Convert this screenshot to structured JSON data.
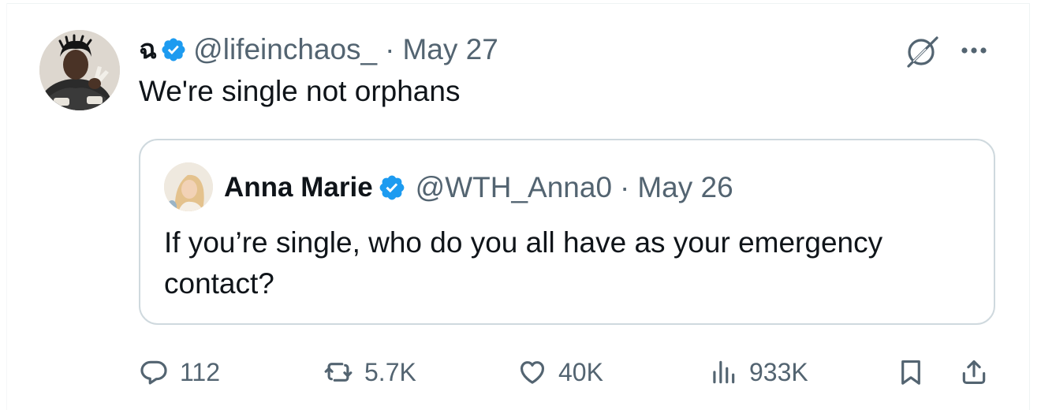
{
  "tweet": {
    "author": {
      "display_name": "ฉ",
      "handle": "@lifeinchaos_",
      "verified": true,
      "avatar_icon": "avatar-photo"
    },
    "separator": "·",
    "date": "May 27",
    "text": "We're single not orphans",
    "quoted": {
      "author": {
        "display_name": "Anna Marie",
        "handle": "@WTH_Anna0",
        "verified": true,
        "avatar_icon": "avatar-photo"
      },
      "separator": "·",
      "date": "May 26",
      "text": "If you’re single, who do you all have as your emergency contact?"
    },
    "actions": {
      "replies": "112",
      "reposts": "5.7K",
      "likes": "40K",
      "views": "933K"
    }
  },
  "colors": {
    "text_primary": "#0f1419",
    "text_secondary": "#536471",
    "verified_blue": "#1d9bf0",
    "border": "#cfd9de"
  },
  "icons": {
    "grok": "grok-icon",
    "more": "more-icon",
    "reply": "reply-icon",
    "repost": "repost-icon",
    "like": "heart-icon",
    "views": "views-icon",
    "bookmark": "bookmark-icon",
    "share": "share-icon"
  }
}
